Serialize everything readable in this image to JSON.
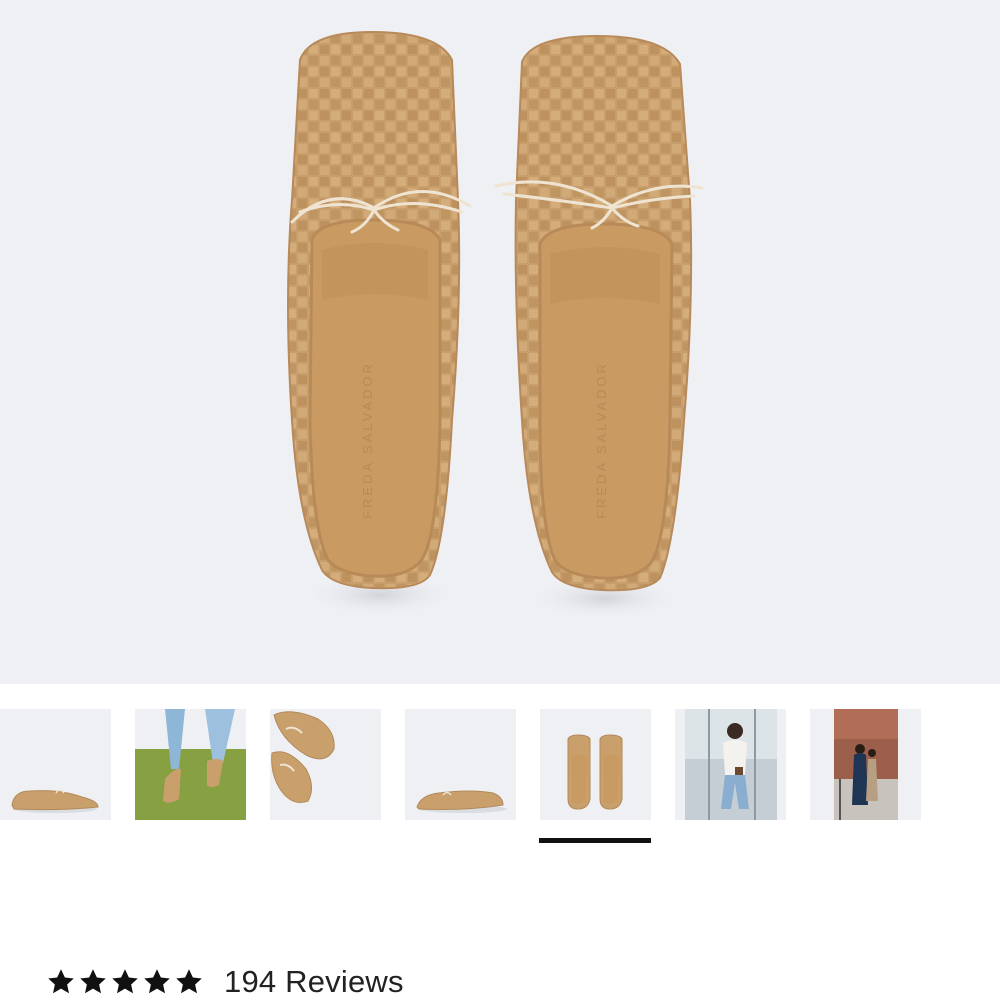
{
  "gallery": {
    "main_image": {
      "alt": "Woven ballet flats top view",
      "insole_brand": "FREDA SALVADOR"
    },
    "thumbnails": [
      {
        "label": "Side view of flat"
      },
      {
        "label": "Worn with jeans on green rug"
      },
      {
        "label": "Pair angled view"
      },
      {
        "label": "Side view single flat"
      },
      {
        "label": "Top view pair"
      },
      {
        "label": "Model in white shirt and jeans"
      },
      {
        "label": "Model in denim outfit on street"
      }
    ],
    "active_index": 4
  },
  "reviews": {
    "stars": 5,
    "rating_icon": "star-icon",
    "count_label": "194 Reviews"
  },
  "colors": {
    "leather": "#c9a06c",
    "insole": "#c99a62",
    "lace": "#efe4d2",
    "background": "#eef0f4",
    "indicator": "#111111"
  }
}
